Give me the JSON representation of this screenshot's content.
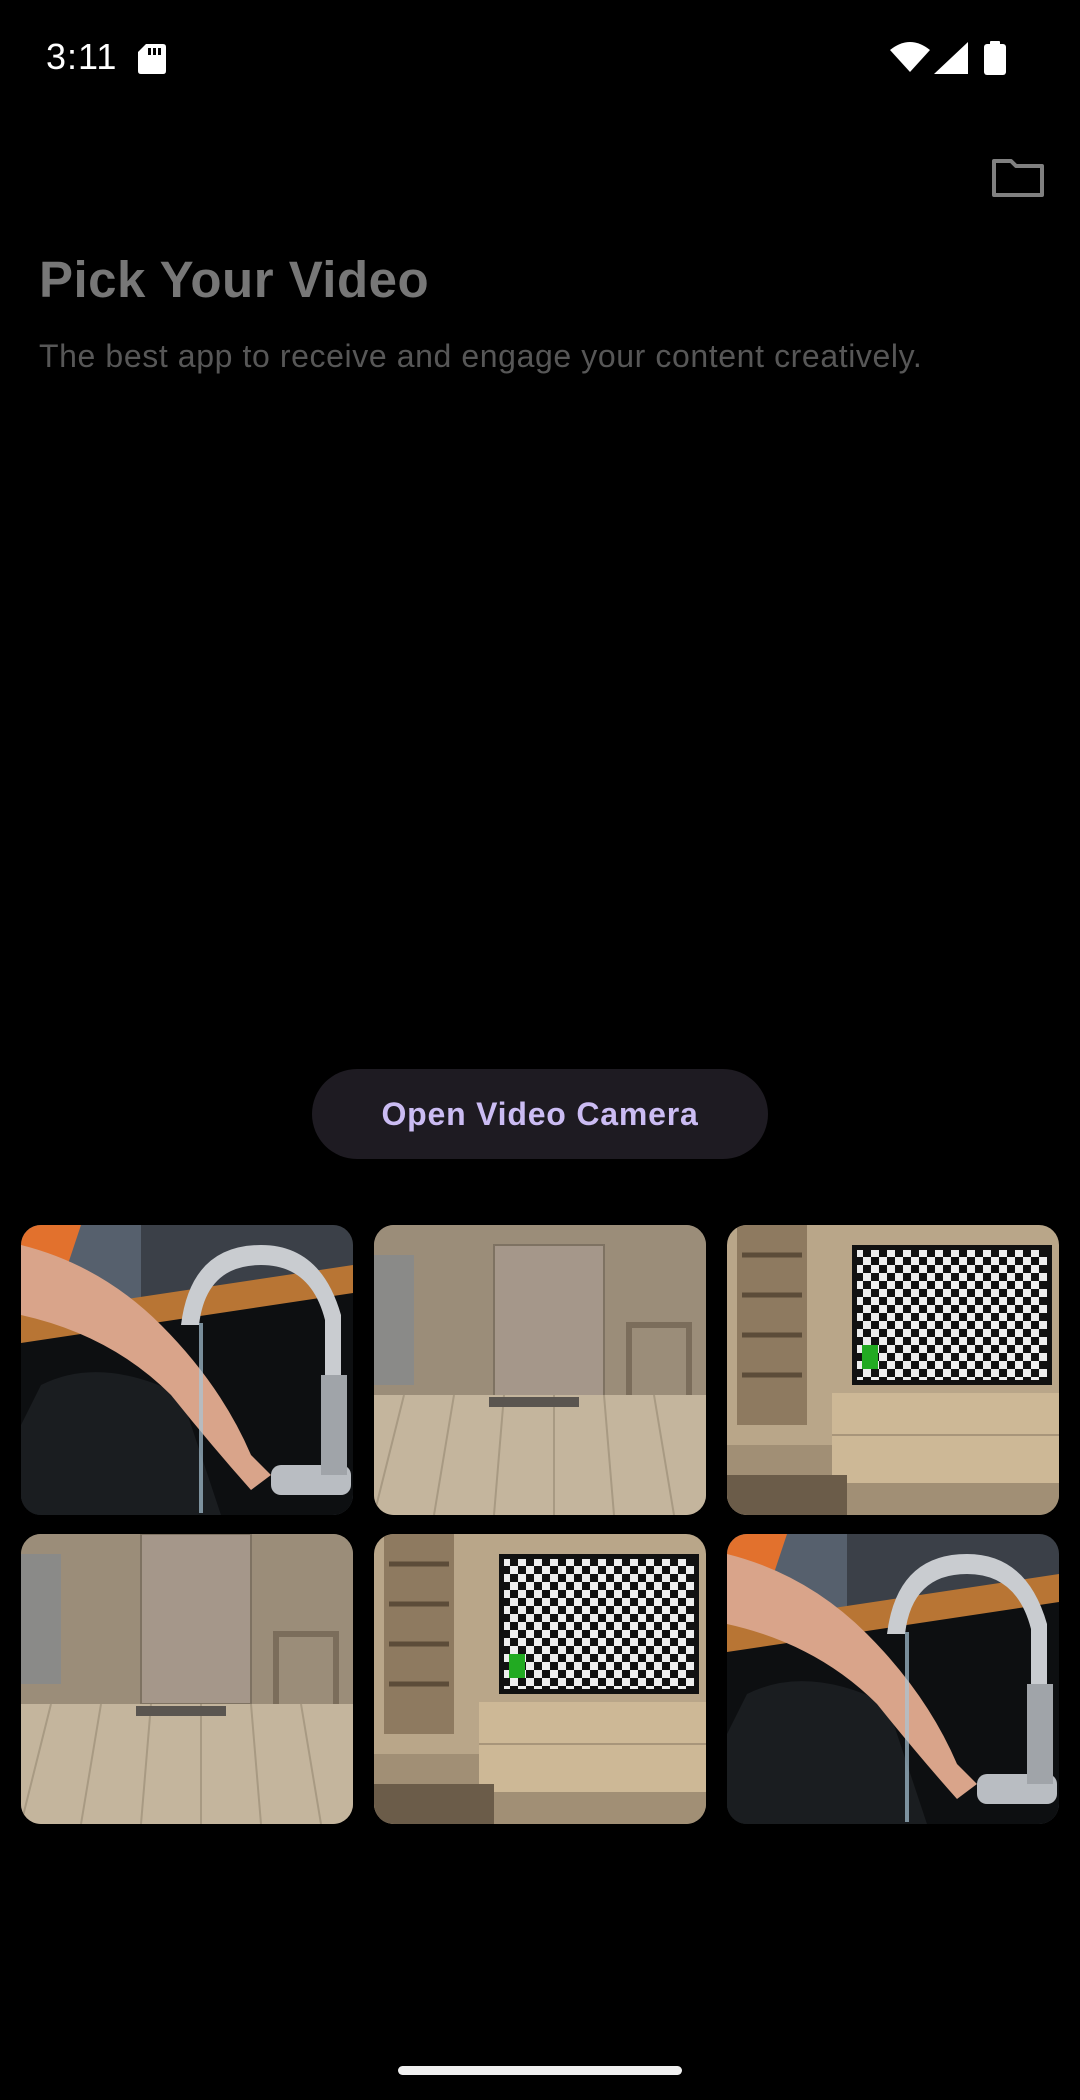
{
  "status_bar": {
    "time": "3:11",
    "icons": [
      "sd-card-icon",
      "wifi-icon",
      "cellular-signal-icon",
      "battery-icon"
    ]
  },
  "header": {
    "action_icon": "folder-icon",
    "title": "Pick Your Video",
    "subtitle": "The best app to receive and engage your content creatively."
  },
  "actions": {
    "camera_label": "Open Video Camera"
  },
  "videos": [
    {
      "scene": "kitchen-faucet"
    },
    {
      "scene": "empty-room-door"
    },
    {
      "scene": "tv-checkerboard-room"
    },
    {
      "scene": "empty-room-door"
    },
    {
      "scene": "tv-checkerboard-room"
    },
    {
      "scene": "kitchen-faucet"
    }
  ],
  "colors": {
    "background": "#000000",
    "title": "#777777",
    "subtitle": "#575757",
    "button_bg": "#1e1b22",
    "button_text": "#cbbcf3"
  }
}
